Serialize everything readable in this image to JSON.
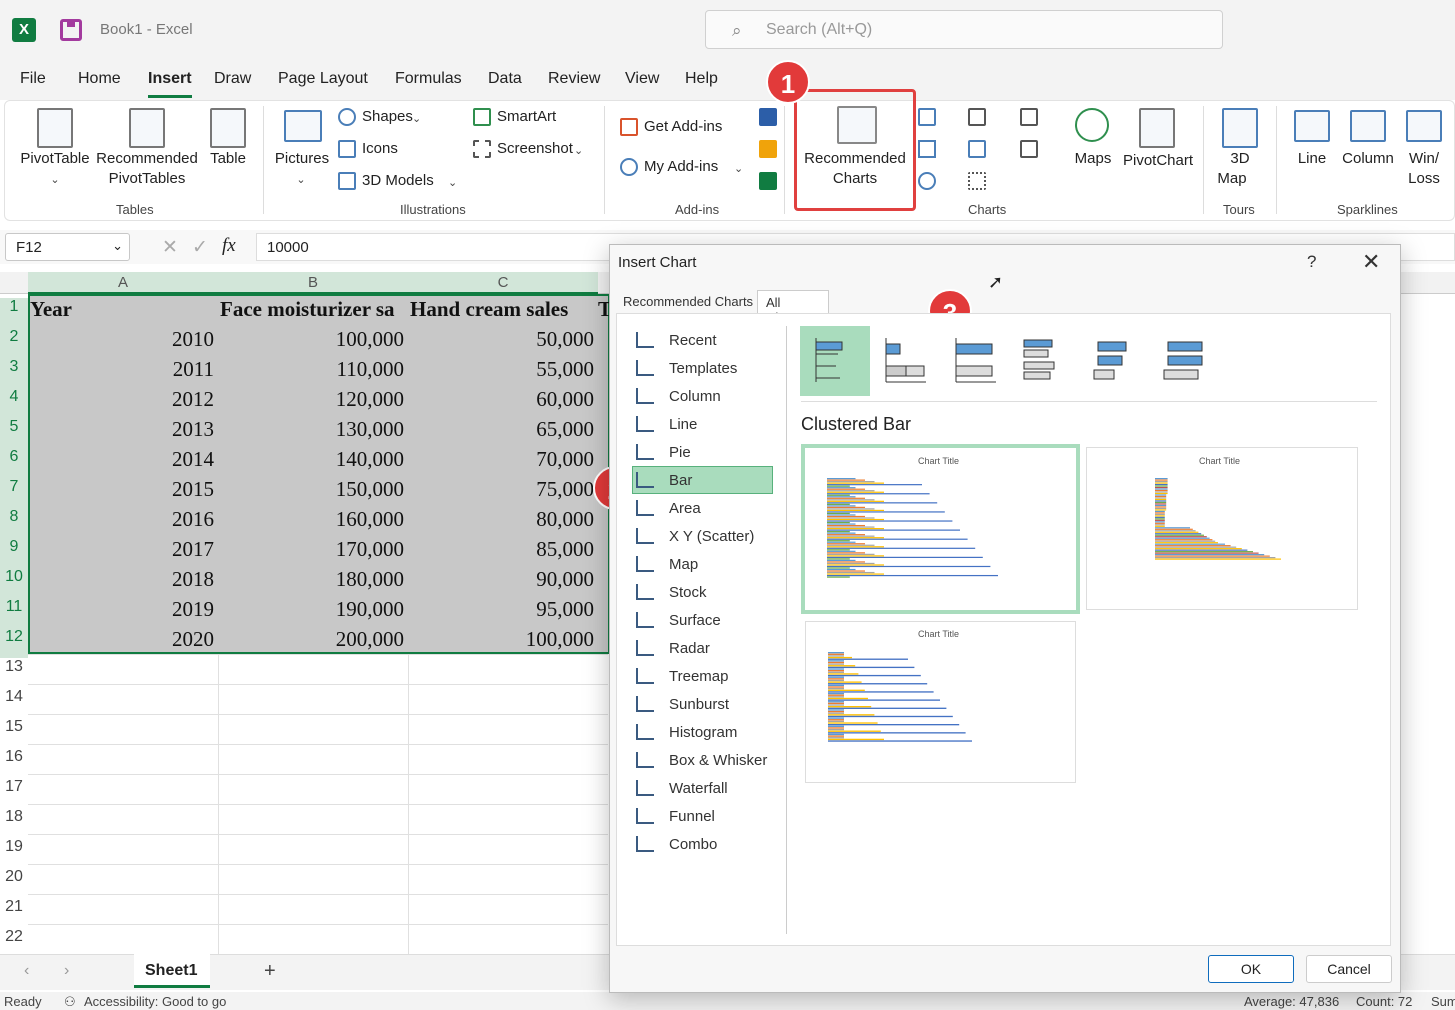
{
  "titlebar": {
    "doc_title": "Book1  -  Excel",
    "search_placeholder": "Search (Alt+Q)"
  },
  "menu": [
    "File",
    "Home",
    "Insert",
    "Draw",
    "Page Layout",
    "Formulas",
    "Data",
    "Review",
    "View",
    "Help"
  ],
  "ribbon": {
    "pivottable": "PivotTable",
    "recommended_pivottables_1": "Recommended",
    "recommended_pivottables_2": "PivotTables",
    "table": "Table",
    "tables_group": "Tables",
    "pictures": "Pictures",
    "shapes": "Shapes",
    "icons": "Icons",
    "models3d": "3D Models",
    "smartart": "SmartArt",
    "screenshot": "Screenshot",
    "illustrations_group": "Illustrations",
    "get_addins": "Get Add-ins",
    "my_addins": "My Add-ins",
    "addins_group": "Add-ins",
    "recommended_charts_1": "Recommended",
    "recommended_charts_2": "Charts",
    "charts_group": "Charts",
    "maps": "Maps",
    "pivotchart": "PivotChart",
    "map3d_1": "3D",
    "map3d_2": "Map",
    "tours_group": "Tours",
    "line": "Line",
    "column": "Column",
    "winloss_1": "Win/",
    "winloss_2": "Loss",
    "sparklines_group": "Sparklines"
  },
  "formula": {
    "namebox": "F12",
    "value": "10000",
    "fx": "fx"
  },
  "columns": [
    "A",
    "B",
    "C"
  ],
  "rows": [
    "1",
    "2",
    "3",
    "4",
    "5",
    "6",
    "7",
    "8",
    "9",
    "10",
    "11",
    "12",
    "13",
    "14",
    "15",
    "16",
    "17",
    "18",
    "19",
    "20",
    "21",
    "22"
  ],
  "table": {
    "headers": [
      "Year",
      "Face moisturizer sa",
      "Hand cream sales",
      "T"
    ],
    "rows": [
      [
        "2010",
        "100,000",
        "50,000"
      ],
      [
        "2011",
        "110,000",
        "55,000"
      ],
      [
        "2012",
        "120,000",
        "60,000"
      ],
      [
        "2013",
        "130,000",
        "65,000"
      ],
      [
        "2014",
        "140,000",
        "70,000"
      ],
      [
        "2015",
        "150,000",
        "75,000"
      ],
      [
        "2016",
        "160,000",
        "80,000"
      ],
      [
        "2017",
        "170,000",
        "85,000"
      ],
      [
        "2018",
        "180,000",
        "90,000"
      ],
      [
        "2019",
        "190,000",
        "95,000"
      ],
      [
        "2020",
        "200,000",
        "100,000"
      ]
    ]
  },
  "sheet": {
    "tab": "Sheet1",
    "add": "+",
    "status_ready": "Ready",
    "status_access": "Accessibility: Good to go",
    "status_avg": "Average: 47,836",
    "status_count": "Count: 72",
    "status_sum": "Sum"
  },
  "dialog": {
    "title": "Insert Chart",
    "help": "?",
    "close": "✕",
    "tab_recommended": "Recommended Charts",
    "tab_all": "All Charts",
    "types": [
      "Recent",
      "Templates",
      "Column",
      "Line",
      "Pie",
      "Bar",
      "Area",
      "X Y (Scatter)",
      "Map",
      "Stock",
      "Surface",
      "Radar",
      "Treemap",
      "Sunburst",
      "Histogram",
      "Box & Whisker",
      "Waterfall",
      "Funnel",
      "Combo"
    ],
    "selected_type": "Bar",
    "subtype_title": "Clustered Bar",
    "preview_title": "Chart Title",
    "ok": "OK",
    "cancel": "Cancel"
  },
  "annotations": [
    "1",
    "2",
    "3"
  ],
  "colors": {
    "excel_green": "#107c41",
    "selection_green": "#a9dcbd",
    "highlight_red": "#e0403f"
  }
}
